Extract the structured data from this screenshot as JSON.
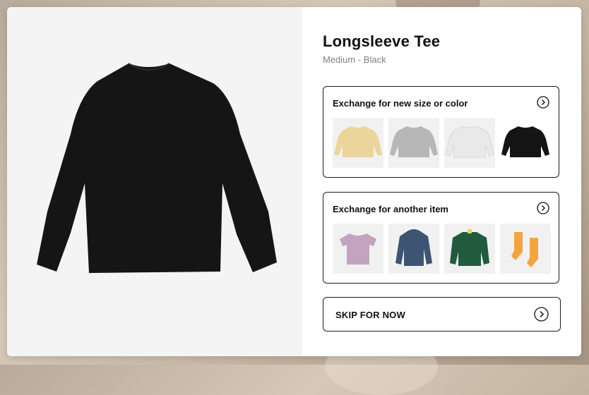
{
  "product": {
    "title": "Longsleeve Tee",
    "variant": "Medium - Black",
    "color": "#151515"
  },
  "exchange_variant": {
    "label": "Exchange for new size or color",
    "icon": "arrow-circle-right-icon",
    "options": [
      {
        "name": "tee-yellow",
        "color": "#ecd59a"
      },
      {
        "name": "tee-gray",
        "color": "#b7b7b7"
      },
      {
        "name": "tee-white",
        "color": "#e9e9e9"
      },
      {
        "name": "tee-black",
        "color": "#141414"
      }
    ]
  },
  "exchange_item": {
    "label": "Exchange for another item",
    "icon": "arrow-circle-right-icon",
    "options": [
      {
        "name": "tshirt-lavender",
        "color": "#c3a3bd"
      },
      {
        "name": "jacket-navy",
        "color": "#3d5573"
      },
      {
        "name": "puffer-green",
        "color": "#1f5b3c"
      },
      {
        "name": "socks-orange",
        "color": "#f4a43f"
      }
    ]
  },
  "skip": {
    "label": "SKIP FOR NOW",
    "icon": "arrow-circle-right-icon"
  }
}
